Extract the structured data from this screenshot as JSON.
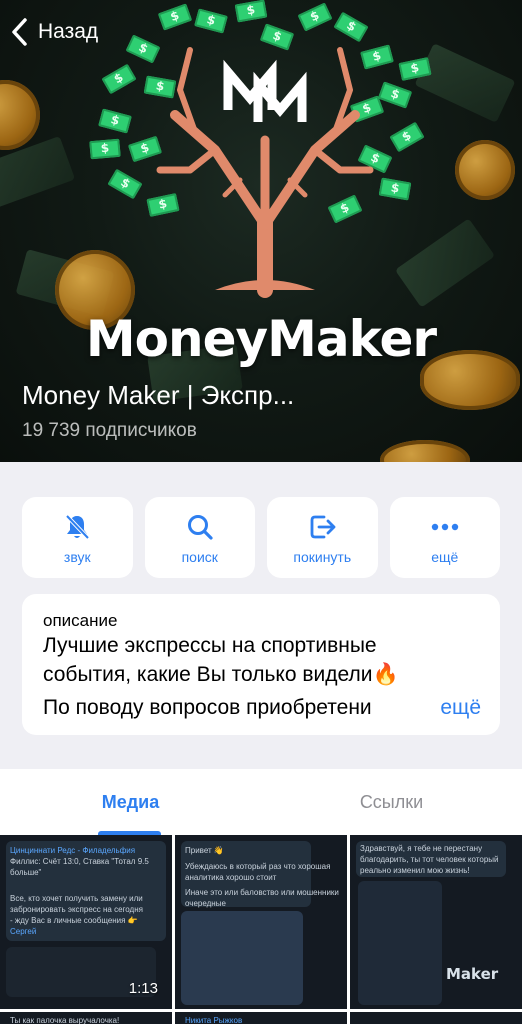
{
  "nav": {
    "back_label": "Назад"
  },
  "channel": {
    "logo_text": "MoneyMaker",
    "title": "Money Maker | Экспр...",
    "subscribers": "19 739 подписчиков"
  },
  "actions": [
    {
      "label": "звук",
      "icon": "bell-muted-icon"
    },
    {
      "label": "поиск",
      "icon": "search-icon"
    },
    {
      "label": "покинуть",
      "icon": "leave-icon"
    },
    {
      "label": "ещё",
      "icon": "more-dots-icon"
    }
  ],
  "description": {
    "label": "описание",
    "lines": [
      "Лучшие экспрессы на спортивные",
      "события, какие Вы только видели🔥",
      "По поводу вопросов приобретени"
    ],
    "more_label": "ещё"
  },
  "tabs": [
    {
      "label": "Медиа",
      "active": true
    },
    {
      "label": "Ссылки",
      "active": false
    }
  ],
  "media": [
    {
      "lines": [
        "Цинциннати Редс - Филадельфия",
        "Филлис: Счёт 13:0, Ставка \"Тотал 9.5",
        "больше\"",
        "Все, кто хочет получить замену или",
        "забронировать экспресс на сегодня",
        "- жду Вас в личные сообщения 👉",
        "Сергей"
      ],
      "duration": "1:13",
      "bottom_text": "Ты как палочка выручалочка!"
    },
    {
      "lines": [
        "Привет 👋",
        "Убеждаюсь в который раз что хорошая",
        "аналитика хорошо стоит",
        "Иначе это или баловство или мошенники",
        "очередные"
      ],
      "bottom_text": "Никита Рыжков"
    },
    {
      "lines": [
        "Здравствуй, я тебе не перестану",
        "благодарить, ты тот человек который",
        "реально изменил мою жизнь!"
      ],
      "watermark": "Maker"
    }
  ],
  "colors": {
    "accent": "#2e7ff0",
    "money_green": "#2ecf72",
    "tree": "#e08a6b"
  }
}
